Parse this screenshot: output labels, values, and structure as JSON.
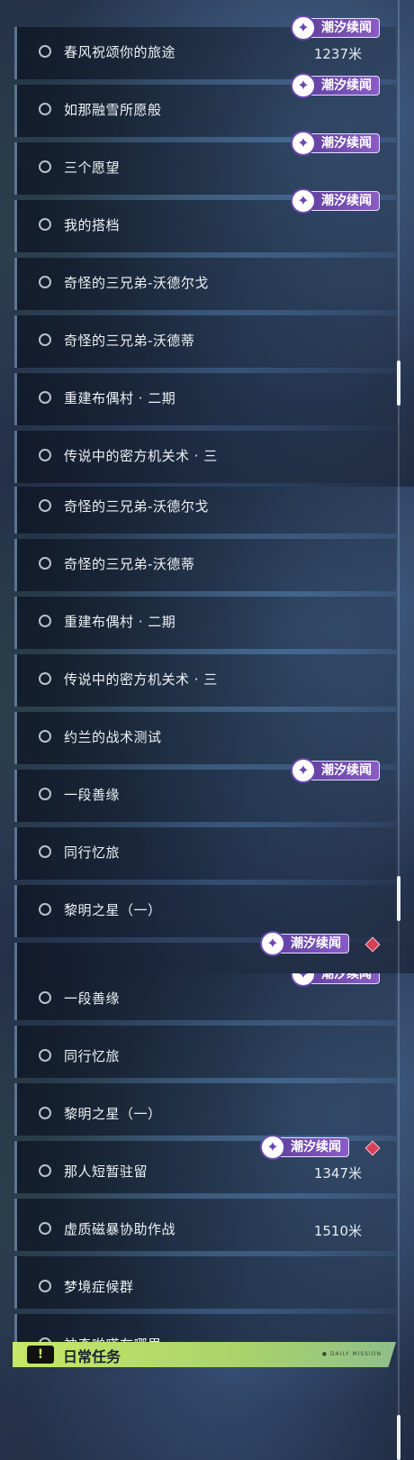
{
  "badge_text": "潮汐续闻",
  "panel1": {
    "items": [
      {
        "label": "春风祝颂你的旅途",
        "distance": "1237米",
        "badge": true
      },
      {
        "label": "如那融雪所愿般",
        "distance": "",
        "badge": true
      },
      {
        "label": "三个愿望",
        "distance": "",
        "badge": true
      },
      {
        "label": "我的搭档",
        "distance": "",
        "badge": true
      },
      {
        "label": "奇怪的三兄弟-沃德尔戈",
        "distance": "",
        "badge": false
      },
      {
        "label": "奇怪的三兄弟-沃德蒂",
        "distance": "",
        "badge": false
      },
      {
        "label": "重建布偶村 · 二期",
        "distance": "",
        "badge": false
      },
      {
        "label": "传说中的密方机关术 · 三",
        "distance": "",
        "badge": false
      }
    ]
  },
  "panel2": {
    "items": [
      {
        "label": "奇怪的三兄弟-沃德尔戈",
        "distance": "",
        "badge": false
      },
      {
        "label": "奇怪的三兄弟-沃德蒂",
        "distance": "",
        "badge": false
      },
      {
        "label": "重建布偶村 · 二期",
        "distance": "",
        "badge": false
      },
      {
        "label": "传说中的密方机关术 · 三",
        "distance": "",
        "badge": false
      },
      {
        "label": "约兰的战术测试",
        "distance": "",
        "badge": false
      },
      {
        "label": "一段善缘",
        "distance": "",
        "badge": true
      },
      {
        "label": "同行忆旅",
        "distance": "",
        "badge": false
      },
      {
        "label": "黎明之星（一）",
        "distance": "",
        "badge": false
      }
    ]
  },
  "panel3": {
    "items": [
      {
        "label": "一段善缘",
        "distance": "",
        "badge": true
      },
      {
        "label": "同行忆旅",
        "distance": "",
        "badge": false
      },
      {
        "label": "黎明之星（一）",
        "distance": "",
        "badge": false
      },
      {
        "label": "那人短暂驻留",
        "distance": "1347米",
        "badge": true
      },
      {
        "label": "虚质磁暴协助作战",
        "distance": "1510米",
        "badge": false
      },
      {
        "label": "梦境症候群",
        "distance": "",
        "badge": false
      },
      {
        "label": "神奇啪嗒在哪里",
        "distance": "",
        "badge": false
      }
    ]
  },
  "daily": {
    "label": "日常任务",
    "icon": "!",
    "tag": "● DAILY MISSION"
  },
  "icons": {
    "badge_icon": "sparkle-icon",
    "status_icon": "circle-icon",
    "alert_icon": "red-diamond-icon"
  },
  "colors": {
    "badge": "#7a52bc",
    "accent": "#c6e86a",
    "diamond": "#d6405a"
  }
}
